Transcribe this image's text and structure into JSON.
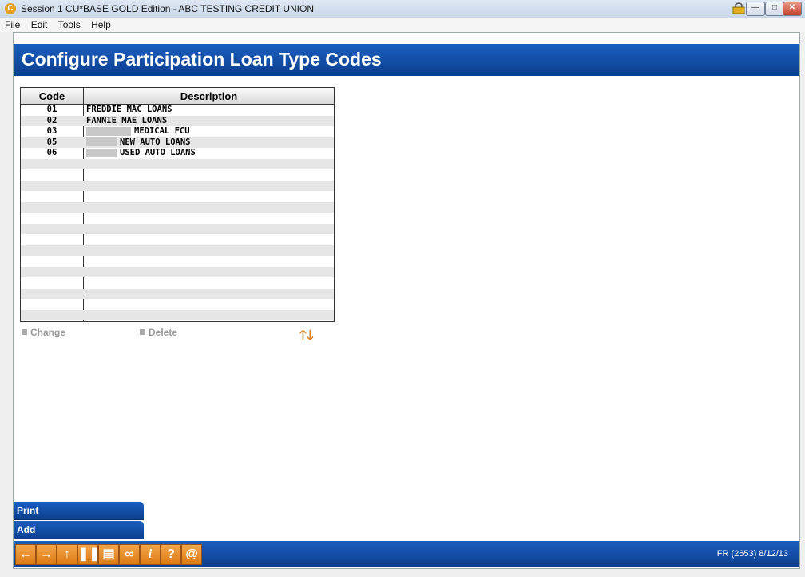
{
  "window": {
    "title": "Session 1 CU*BASE GOLD Edition - ABC TESTING CREDIT UNION"
  },
  "menu": [
    "File",
    "Edit",
    "Tools",
    "Help"
  ],
  "page": {
    "title": "Configure Participation Loan Type Codes"
  },
  "table": {
    "columns": [
      "Code",
      "Description"
    ],
    "rows": [
      {
        "code": "01",
        "desc": "FREDDIE MAC LOANS",
        "redacted": false
      },
      {
        "code": "02",
        "desc": "FANNIE MAE LOANS",
        "redacted": false
      },
      {
        "code": "03",
        "desc": "MEDICAL FCU",
        "redacted": true
      },
      {
        "code": "05",
        "desc": "NEW AUTO LOANS",
        "redacted": true
      },
      {
        "code": "06",
        "desc": "USED AUTO LOANS",
        "redacted": true
      }
    ],
    "empty_rows": 15
  },
  "actions": {
    "change": "Change",
    "delete": "Delete"
  },
  "side_buttons": {
    "print": "Print",
    "add": "Add"
  },
  "footer": {
    "icons": [
      "back-icon",
      "forward-icon",
      "up-icon",
      "pause-icon",
      "printer-icon",
      "link-icon",
      "info-icon",
      "help-icon",
      "at-icon"
    ],
    "status": "FR (2653) 8/12/13"
  },
  "colors": {
    "header": "#1b5ec0",
    "accent": "#dd7a14"
  }
}
